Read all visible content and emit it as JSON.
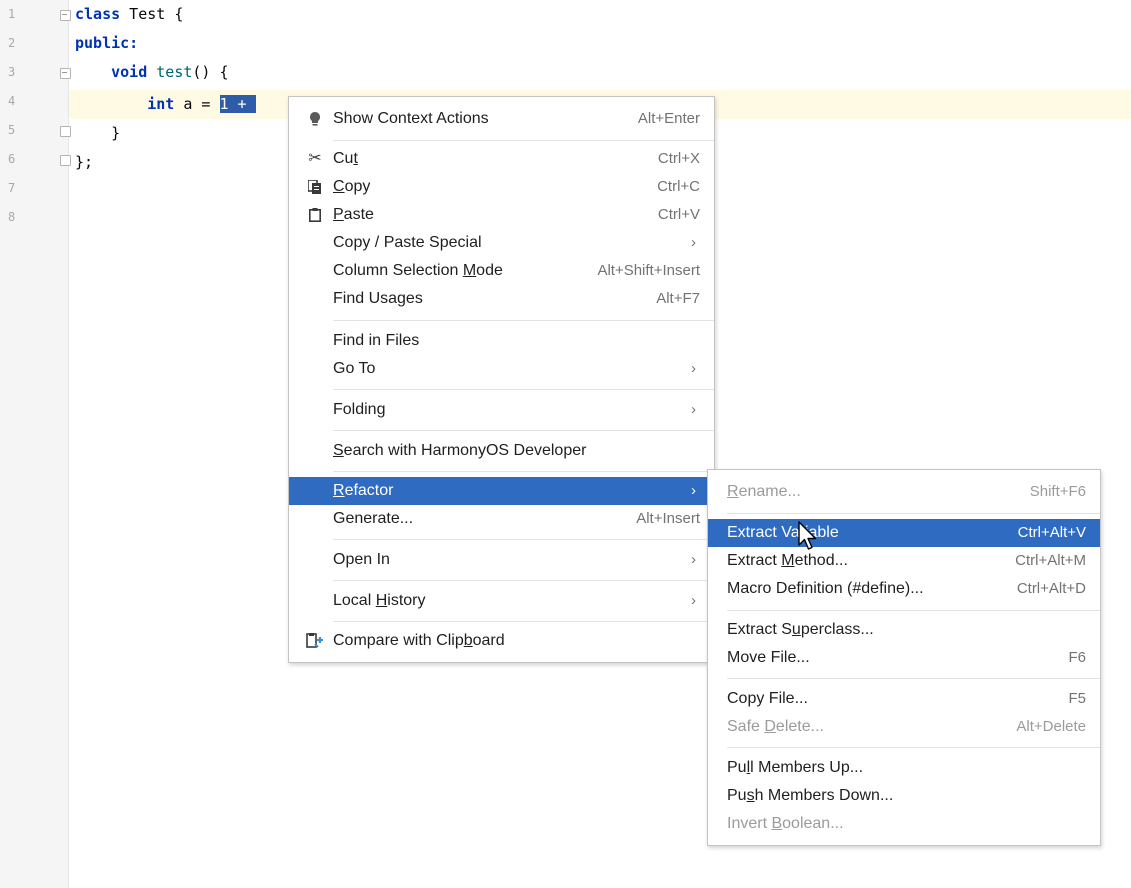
{
  "editor": {
    "line_numbers": [
      "1",
      "2",
      "3",
      "4",
      "5",
      "6",
      "7",
      "8"
    ],
    "code": {
      "l1_kw": "class",
      "l1_rest": " Test {",
      "l2_kw": "public:",
      "l3_kw": "void",
      "l3_fn": "test",
      "l3_rest": "() {",
      "l4_kw": "int",
      "l4_rest": " a = ",
      "l4_sel": "1 + ",
      "l5": "}",
      "l6": "};"
    }
  },
  "context_menu": {
    "items": {
      "show_context_actions": {
        "label": "Show Context Actions",
        "shortcut": "Alt+Enter",
        "icon": "lightbulb-icon"
      },
      "cut": {
        "label_pre": "Cu",
        "label_u": "t",
        "label_post": "",
        "shortcut": "Ctrl+X",
        "icon": "scissors-icon"
      },
      "copy": {
        "label_pre": "",
        "label_u": "C",
        "label_post": "opy",
        "shortcut": "Ctrl+C",
        "icon": "copy-icon"
      },
      "paste": {
        "label_pre": "",
        "label_u": "P",
        "label_post": "aste",
        "shortcut": "Ctrl+V",
        "icon": "clipboard-icon"
      },
      "copy_paste_special": {
        "label": "Copy / Paste Special"
      },
      "column_selection": {
        "label_pre": "Column Selection ",
        "label_u": "M",
        "label_post": "ode",
        "shortcut": "Alt+Shift+Insert"
      },
      "find_usages": {
        "label": "Find Usages",
        "shortcut": "Alt+F7"
      },
      "find_in_files": {
        "label": "Find in Files"
      },
      "go_to": {
        "label": "Go To"
      },
      "folding": {
        "label": "Folding"
      },
      "search_harmony": {
        "label_pre": "",
        "label_u": "S",
        "label_post": "earch with HarmonyOS Developer"
      },
      "refactor": {
        "label_pre": "",
        "label_u": "R",
        "label_post": "efactor"
      },
      "generate": {
        "label": "Generate...",
        "shortcut": "Alt+Insert"
      },
      "open_in": {
        "label": "Open In"
      },
      "local_history": {
        "label_pre": "Local ",
        "label_u": "H",
        "label_post": "istory"
      },
      "compare_clipboard": {
        "label_pre": "Compare with Clip",
        "label_u": "b",
        "label_post": "oard",
        "icon": "compare-icon"
      }
    }
  },
  "refactor_menu": {
    "items": {
      "rename": {
        "label_pre": "",
        "label_u": "R",
        "label_post": "ename...",
        "shortcut": "Shift+F6"
      },
      "extract_variable": {
        "label": "Extract Variable",
        "shortcut": "Ctrl+Alt+V"
      },
      "extract_method": {
        "label_pre": "Extract ",
        "label_u": "M",
        "label_post": "ethod...",
        "shortcut": "Ctrl+Alt+M"
      },
      "macro_definition": {
        "label": "Macro Definition (#define)...",
        "shortcut": "Ctrl+Alt+D"
      },
      "extract_superclass": {
        "label_pre": "Extract S",
        "label_u": "u",
        "label_post": "perclass..."
      },
      "move_file": {
        "label": "Move File...",
        "shortcut": "F6"
      },
      "copy_file": {
        "label": "Copy File...",
        "shortcut": "F5"
      },
      "safe_delete": {
        "label_pre": "Safe ",
        "label_u": "D",
        "label_post": "elete...",
        "shortcut": "Alt+Delete"
      },
      "pull_members_up": {
        "label_pre": "Pu",
        "label_u": "l",
        "label_post": "l Members Up..."
      },
      "push_members_down": {
        "label_pre": "Pu",
        "label_u": "s",
        "label_post": "h Members Down..."
      },
      "invert_boolean": {
        "label_pre": "Invert ",
        "label_u": "B",
        "label_post": "oolean..."
      }
    }
  },
  "colors": {
    "highlight": "#2e6bc1",
    "selection": "#2e5ca8",
    "current_line": "#fffae3",
    "keyword": "#0033b3"
  }
}
